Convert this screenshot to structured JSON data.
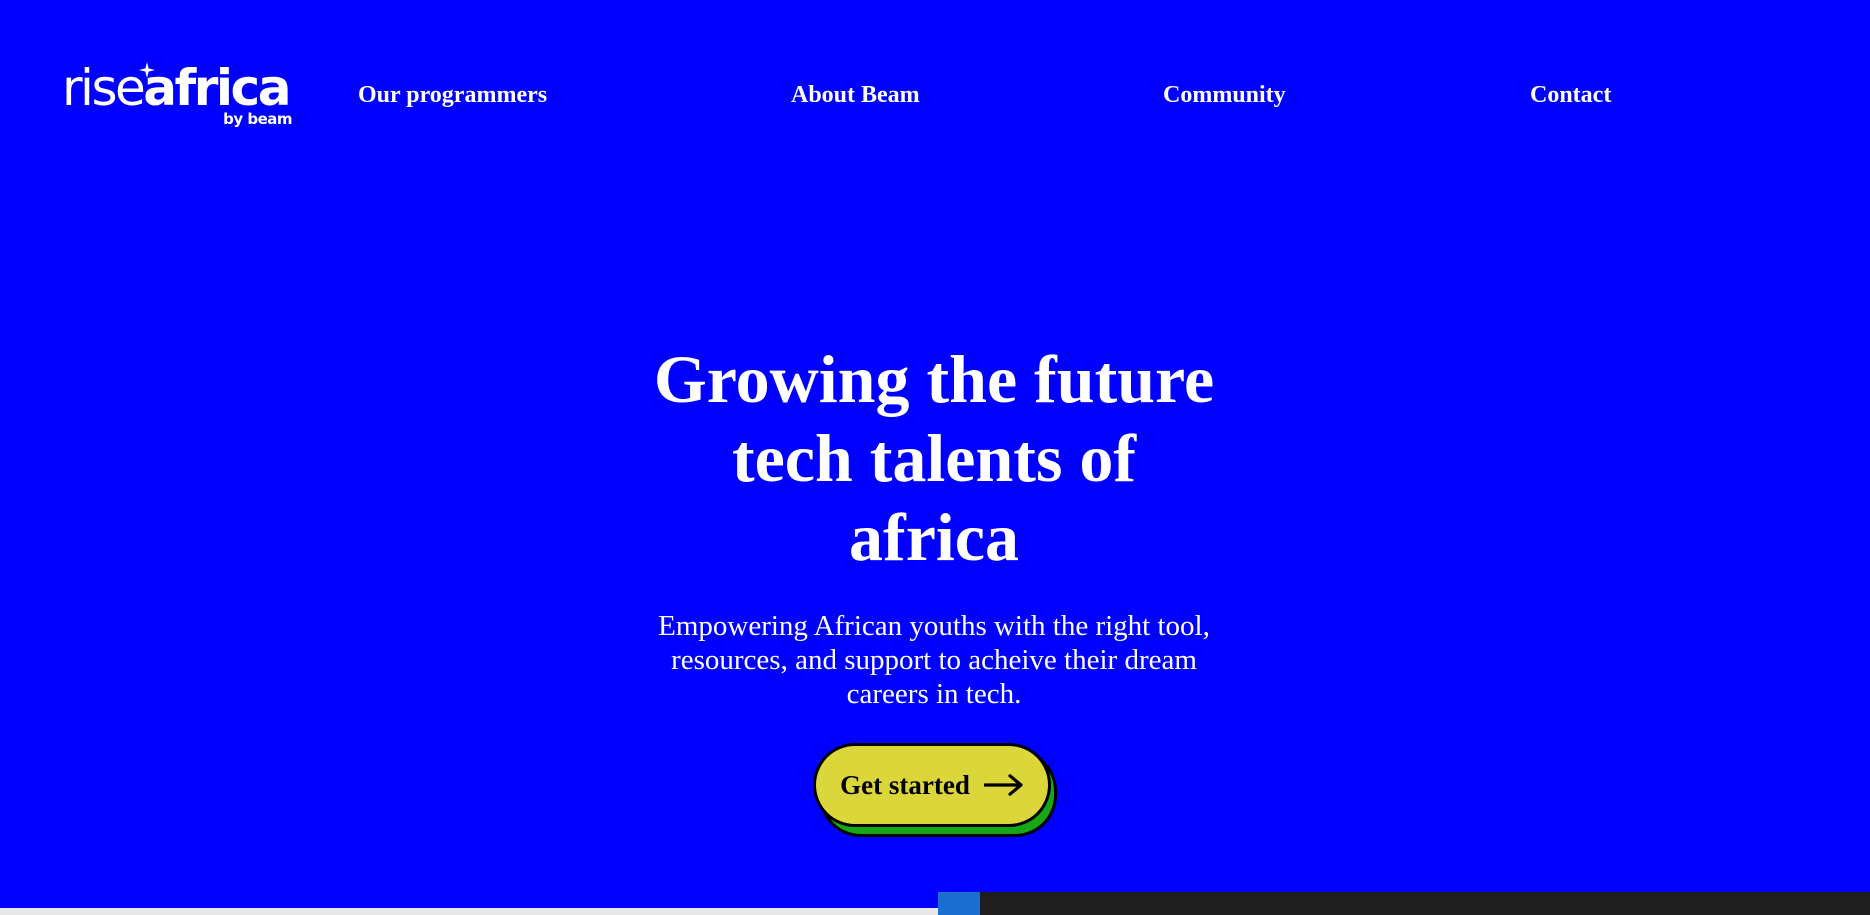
{
  "brand": {
    "logo_light": "rise",
    "logo_bold": "africa",
    "logo_by": "by beam",
    "logo_icon": "sparkle-star-icon"
  },
  "nav": {
    "items": [
      {
        "label": "Our programmers"
      },
      {
        "label": "About Beam"
      },
      {
        "label": "Community"
      },
      {
        "label": "Contact"
      }
    ]
  },
  "hero": {
    "title_line1": "Growing the future",
    "title_line2": "tech talents of",
    "title_line3": "africa",
    "subtitle": "Empowering African youths with the right tool, resources, and support to acheive their dream careers in tech.",
    "cta_label": "Get started",
    "cta_icon": "arrow-right-icon"
  },
  "colors": {
    "background": "#0000fe",
    "cta_fill": "#dbd63a",
    "cta_shadow": "#16a616",
    "text": "#ffffff"
  }
}
